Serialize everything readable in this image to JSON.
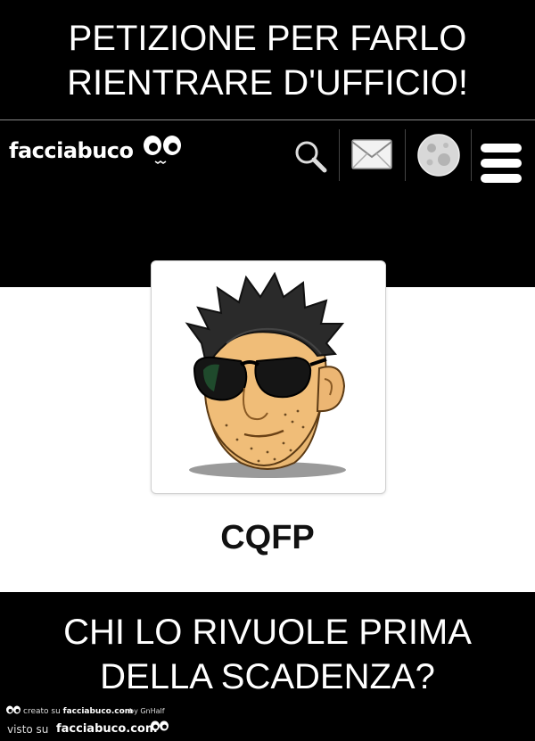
{
  "top_caption": {
    "line1": "PETIZIONE PER FARLO",
    "line2": "RIENTRARE D'UFFICIO!"
  },
  "header": {
    "logo_text": "facciabuco",
    "icons": [
      "search-icon",
      "mail-icon",
      "moon-avatar-icon",
      "menu-icon"
    ]
  },
  "profile": {
    "username": "CQFP"
  },
  "bottom_caption": {
    "line1": "CHI LO RIVUOLE PRIMA",
    "line2": "DELLA SCADENZA?"
  },
  "credits": {
    "created_prefix": "creato su",
    "created_site": "facciabuco.com",
    "by": "by GnHalf",
    "seen_prefix": "visto su",
    "seen_site": "facciabuco.com"
  },
  "colors": {
    "background": "#000000",
    "card_background": "#ffffff",
    "text_dark": "#111111"
  }
}
